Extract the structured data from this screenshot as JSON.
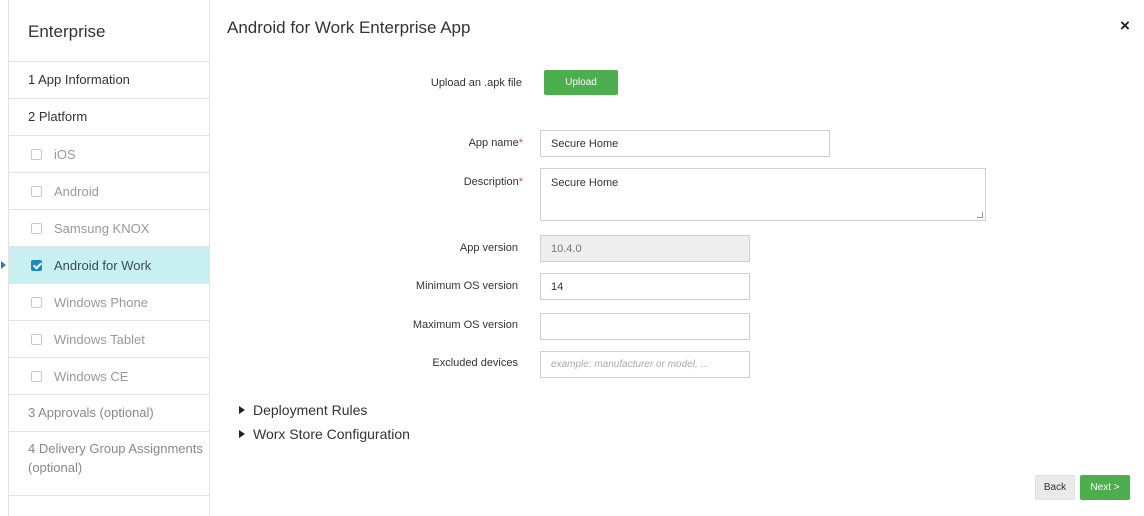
{
  "sidebar": {
    "header": "Enterprise",
    "step1": "1 App Information",
    "step2": "2 Platform",
    "platforms": [
      {
        "label": "iOS",
        "checked": false
      },
      {
        "label": "Android",
        "checked": false
      },
      {
        "label": "Samsung KNOX",
        "checked": false
      },
      {
        "label": "Android for Work",
        "checked": true
      },
      {
        "label": "Windows Phone",
        "checked": false
      },
      {
        "label": "Windows Tablet",
        "checked": false
      },
      {
        "label": "Windows CE",
        "checked": false
      }
    ],
    "step3": "3 Approvals (optional)",
    "step4": "4 Delivery Group Assignments (optional)"
  },
  "main": {
    "title": "Android for Work Enterprise App",
    "close_icon": "×",
    "upload_label": "Upload an .apk file",
    "upload_button": "Upload",
    "app_name_label": "App name",
    "app_name_value": "Secure Home",
    "description_label": "Description",
    "description_value": "Secure Home",
    "required_marker": "*",
    "app_version_label": "App version",
    "app_version_value": "10.4.0",
    "min_os_label": "Minimum OS version",
    "min_os_value": "14",
    "max_os_label": "Maximum OS version",
    "max_os_value": "",
    "excluded_label": "Excluded devices",
    "excluded_placeholder": "example: manufacturer or model, ...",
    "deployment_rules": "Deployment Rules",
    "worx_store": "Worx Store Configuration"
  },
  "footer": {
    "back": "Back",
    "next": "Next >"
  },
  "colors": {
    "accent_green": "#4cae4c",
    "active_row": "#c9f0f1",
    "checkbox_blue": "#1f88c4",
    "required_red": "#e04848"
  }
}
